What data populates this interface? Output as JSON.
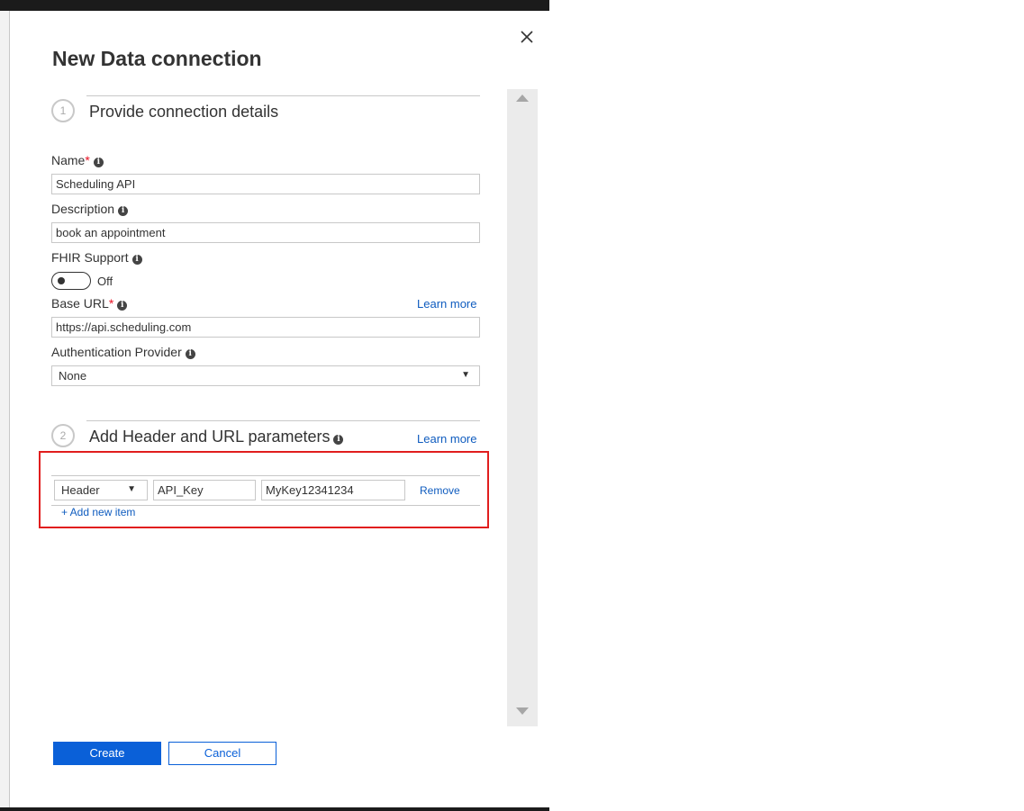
{
  "dialog": {
    "title": "New Data connection"
  },
  "sections": [
    {
      "number": "1",
      "title": "Provide connection details"
    },
    {
      "number": "2",
      "title": "Add Header and URL parameters",
      "learn_more": "Learn more"
    }
  ],
  "fields": {
    "name": {
      "label": "Name",
      "required_mark": "*",
      "value": "Scheduling API"
    },
    "description": {
      "label": "Description",
      "value": "book an appointment"
    },
    "fhir": {
      "label": "FHIR Support",
      "state": "Off"
    },
    "base_url": {
      "label": "Base URL",
      "required_mark": "*",
      "value": "https://api.scheduling.com",
      "learn_more": "Learn more"
    },
    "auth": {
      "label": "Authentication Provider",
      "value": "None"
    }
  },
  "info_glyph": "i",
  "caret_glyph": "▼",
  "parameters": {
    "rows": [
      {
        "type": "Header",
        "key": "API_Key",
        "value": "MyKey12341234",
        "remove": "Remove"
      }
    ],
    "add_item": "+ Add new item"
  },
  "buttons": {
    "create": "Create",
    "cancel": "Cancel"
  },
  "colors": {
    "accent": "#0a60d8",
    "link": "#0f5cbf",
    "highlight": "#e11e1e",
    "required": "#e81123"
  },
  "icons": {
    "close": "close-icon",
    "info": "info-icon",
    "scroll_up": "scroll-up-arrow",
    "scroll_down": "scroll-down-arrow"
  }
}
